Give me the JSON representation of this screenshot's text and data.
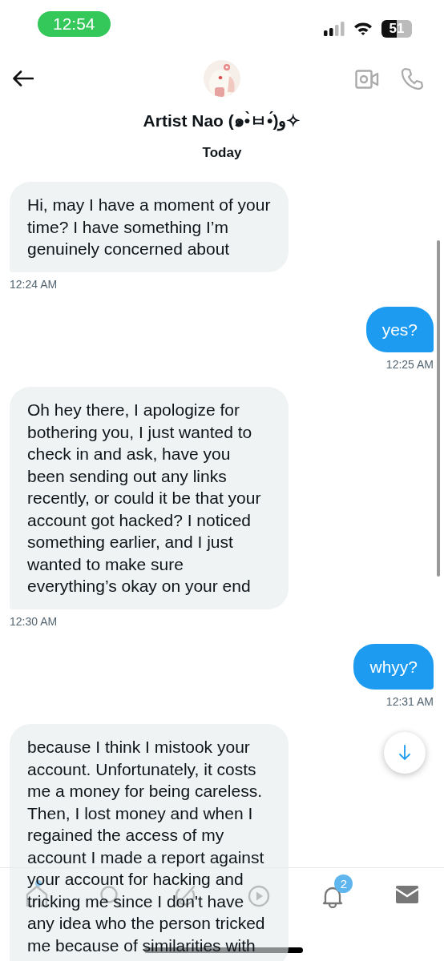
{
  "status_bar": {
    "time": "12:54",
    "battery": "51"
  },
  "header": {
    "name": "Artist Nao (๑•̀ㅂ•́)و✧",
    "date": "Today"
  },
  "messages": [
    {
      "kind": "received",
      "text": "Hi, may I have a moment of your time? I have something I’m genuinely concerned about",
      "time": "12:24 AM"
    },
    {
      "kind": "sent",
      "text": "yes?",
      "time": "12:25 AM"
    },
    {
      "kind": "received",
      "text": "Oh hey there, I apologize for bothering you, I just wanted to check in and ask, have you been sending out any links recently, or could it be that your account got hacked? I noticed something earlier, and I just wanted to make sure everything’s okay on your end",
      "time": "12:30 AM"
    },
    {
      "kind": "sent",
      "text": "whyy?",
      "time": "12:31 AM"
    },
    {
      "kind": "received",
      "text": "because I think I mistook your account. Unfortunately, it costs me a money for being careless. Then, I lost money and when I regained the access of my account I made a report against your account for hacking and tricking me since I don't have any idea who the person tricked me because of similarities with"
    }
  ],
  "nav": [
    {
      "kind": "home",
      "dot": true
    },
    {
      "kind": "search"
    },
    {
      "kind": "slash"
    },
    {
      "kind": "play"
    },
    {
      "kind": "bell",
      "badge": "2"
    },
    {
      "kind": "mail"
    }
  ]
}
